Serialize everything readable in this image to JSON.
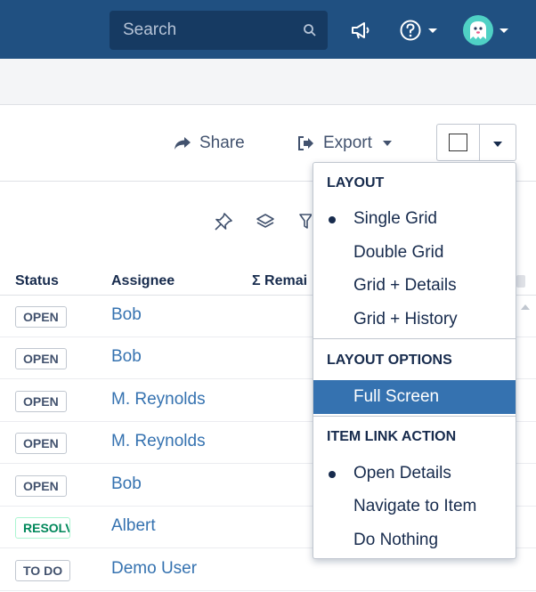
{
  "nav": {
    "search_placeholder": "Search"
  },
  "toolbar": {
    "share_label": "Share",
    "export_label": "Export"
  },
  "table": {
    "columns": [
      "Status",
      "Assignee",
      "Σ Remai"
    ],
    "rows": [
      {
        "status": "OPEN",
        "assignee": "Bob"
      },
      {
        "status": "OPEN",
        "assignee": "Bob"
      },
      {
        "status": "OPEN",
        "assignee": "M. Reynolds"
      },
      {
        "status": "OPEN",
        "assignee": "M. Reynolds"
      },
      {
        "status": "OPEN",
        "assignee": "Bob"
      },
      {
        "status": "RESOLVED",
        "assignee": "Albert"
      },
      {
        "status": "TO DO",
        "assignee": "Demo User"
      }
    ]
  },
  "menu": {
    "layout_header": "LAYOUT",
    "layout_items": [
      "Single Grid",
      "Double Grid",
      "Grid + Details",
      "Grid + History"
    ],
    "layout_options_header": "LAYOUT OPTIONS",
    "layout_option_items": [
      "Full Screen"
    ],
    "item_link_header": "ITEM LINK ACTION",
    "item_link_items": [
      "Open Details",
      "Navigate to Item",
      "Do Nothing"
    ]
  },
  "colors": {
    "nav_bg": "#205081",
    "link": "#3572b0",
    "menu_active": "#3572b0",
    "resolved": "#00875a"
  }
}
